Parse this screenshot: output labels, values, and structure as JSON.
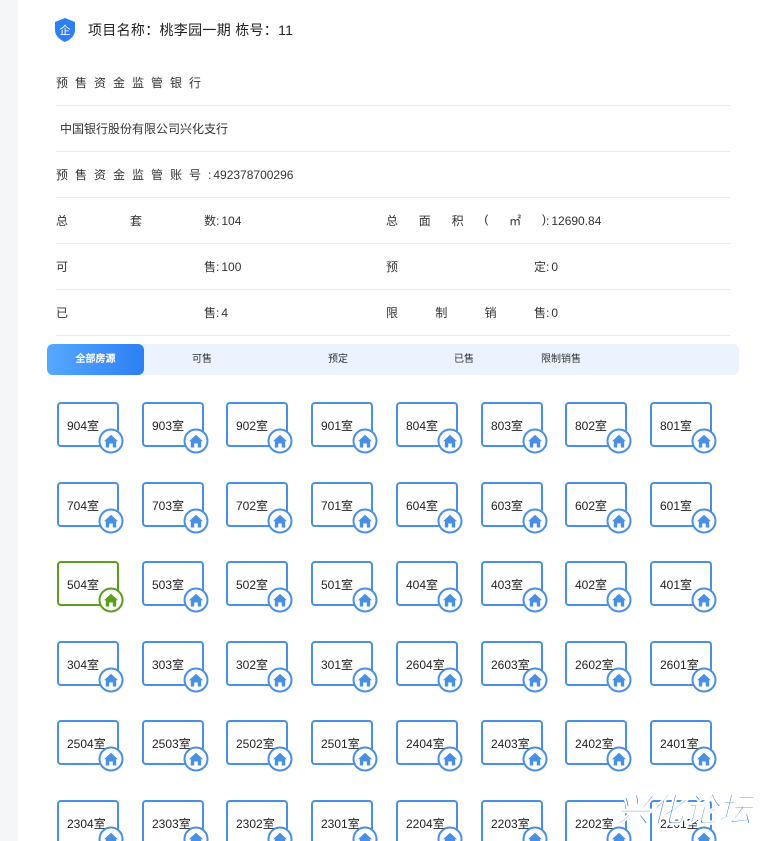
{
  "header": {
    "title": "项目名称：桃李园一期 栋号：11",
    "icon_text": "企",
    "icon": "shield-icon"
  },
  "info": {
    "bank_label": "预售资金监管银行",
    "bank_name": "中国银行股份有限公司兴化支行",
    "account_label": "预售资金监管账号",
    "account_value": "492378700296",
    "total_sets_label": "总套数",
    "total_sets_value": "104",
    "total_area_label": "总面积(㎡)",
    "total_area_value": "12690.84",
    "available_label": "可售",
    "available_value": "100",
    "reserved_label": "预定",
    "reserved_value": "0",
    "sold_label": "已售",
    "sold_value": "4",
    "restricted_label": "限制销售",
    "restricted_value": "0"
  },
  "tabs": [
    {
      "label": "全部房源",
      "active": true
    },
    {
      "label": "可售",
      "active": false
    },
    {
      "label": "预定",
      "active": false
    },
    {
      "label": "已售",
      "active": false
    },
    {
      "label": "限制销售",
      "active": false
    }
  ],
  "units": [
    {
      "label": "904室",
      "status": "available"
    },
    {
      "label": "903室",
      "status": "available"
    },
    {
      "label": "902室",
      "status": "available"
    },
    {
      "label": "901室",
      "status": "available"
    },
    {
      "label": "804室",
      "status": "available"
    },
    {
      "label": "803室",
      "status": "available"
    },
    {
      "label": "802室",
      "status": "available"
    },
    {
      "label": "801室",
      "status": "available"
    },
    {
      "label": "704室",
      "status": "available"
    },
    {
      "label": "703室",
      "status": "available"
    },
    {
      "label": "702室",
      "status": "available"
    },
    {
      "label": "701室",
      "status": "available"
    },
    {
      "label": "604室",
      "status": "available"
    },
    {
      "label": "603室",
      "status": "available"
    },
    {
      "label": "602室",
      "status": "available"
    },
    {
      "label": "601室",
      "status": "available"
    },
    {
      "label": "504室",
      "status": "sold"
    },
    {
      "label": "503室",
      "status": "available"
    },
    {
      "label": "502室",
      "status": "available"
    },
    {
      "label": "501室",
      "status": "available"
    },
    {
      "label": "404室",
      "status": "available"
    },
    {
      "label": "403室",
      "status": "available"
    },
    {
      "label": "402室",
      "status": "available"
    },
    {
      "label": "401室",
      "status": "available"
    },
    {
      "label": "304室",
      "status": "available"
    },
    {
      "label": "303室",
      "status": "available"
    },
    {
      "label": "302室",
      "status": "available"
    },
    {
      "label": "301室",
      "status": "available"
    },
    {
      "label": "2604室",
      "status": "available"
    },
    {
      "label": "2603室",
      "status": "available"
    },
    {
      "label": "2602室",
      "status": "available"
    },
    {
      "label": "2601室",
      "status": "available"
    },
    {
      "label": "2504室",
      "status": "available"
    },
    {
      "label": "2503室",
      "status": "available"
    },
    {
      "label": "2502室",
      "status": "available"
    },
    {
      "label": "2501室",
      "status": "available"
    },
    {
      "label": "2404室",
      "status": "available"
    },
    {
      "label": "2403室",
      "status": "available"
    },
    {
      "label": "2402室",
      "status": "available"
    },
    {
      "label": "2401室",
      "status": "available"
    },
    {
      "label": "2304室",
      "status": "available"
    },
    {
      "label": "2303室",
      "status": "available"
    },
    {
      "label": "2302室",
      "status": "available"
    },
    {
      "label": "2301室",
      "status": "available"
    },
    {
      "label": "2204室",
      "status": "available"
    },
    {
      "label": "2203室",
      "status": "available"
    },
    {
      "label": "2202室",
      "status": "available"
    },
    {
      "label": "2201室",
      "status": "available"
    }
  ],
  "colors": {
    "available": "#4a90e2",
    "sold": "#5a9e1c",
    "accent": "#2d7ff5"
  },
  "watermark": {
    "text": "兴化论坛"
  }
}
